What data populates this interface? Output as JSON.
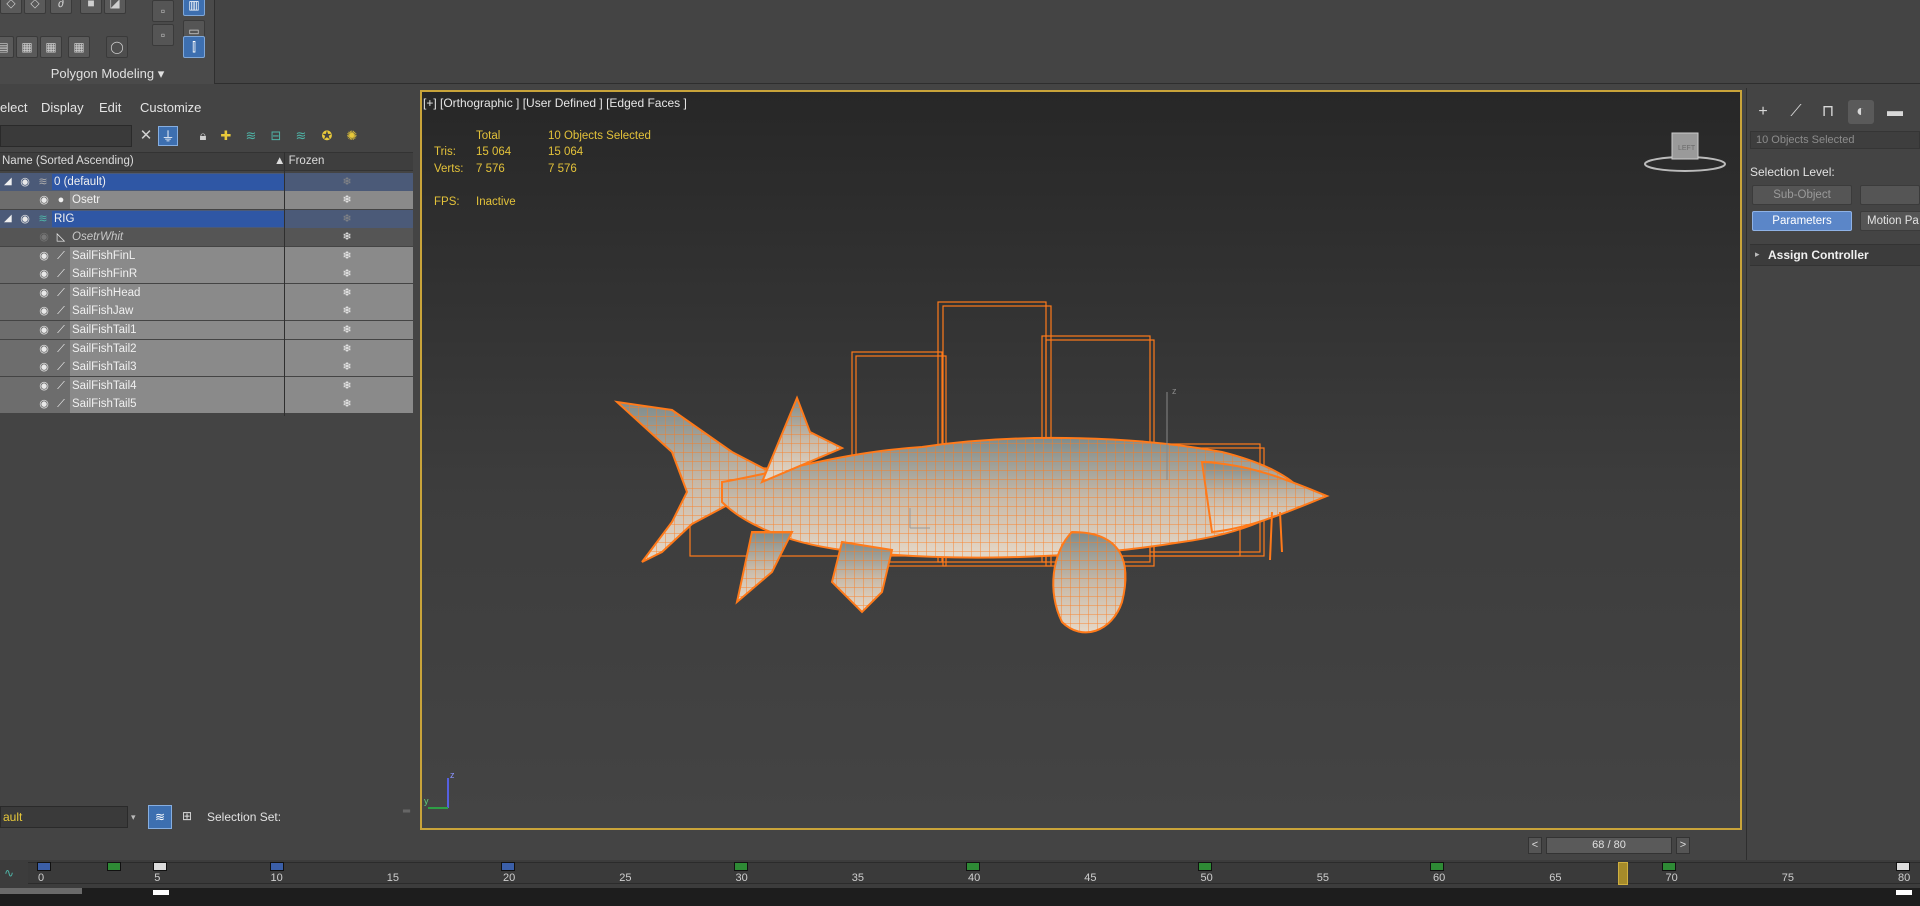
{
  "ribbon": {
    "tab_label": "Polygon Modeling ▾"
  },
  "explorer": {
    "menus": [
      "elect",
      "Display",
      "Edit",
      "Customize"
    ],
    "columns": {
      "name": "Name (Sorted Ascending)",
      "frozen": "▲ Frozen"
    },
    "rows": [
      {
        "name": "0 (default)"
      },
      {
        "name": "Osetr"
      },
      {
        "name": "RIG"
      },
      {
        "name": "OsetrWhit"
      },
      {
        "name": "SailFishFinL"
      },
      {
        "name": "SailFishFinR"
      },
      {
        "name": "SailFishHead"
      },
      {
        "name": "SailFishJaw"
      },
      {
        "name": "SailFishTail1"
      },
      {
        "name": "SailFishTail2"
      },
      {
        "name": "SailFishTail3"
      },
      {
        "name": "SailFishTail4"
      },
      {
        "name": "SailFishTail5"
      }
    ],
    "layer_dropdown": "ault",
    "selection_set_label": "Selection Set:"
  },
  "viewport": {
    "label": "[+] [Orthographic ] [User Defined ] [Edged Faces ]",
    "stats": {
      "total_header": "Total",
      "selected_header": "10 Objects Selected",
      "tris_label": "Tris:",
      "tris_total": "15 064",
      "tris_selected": "15 064",
      "verts_label": "Verts:",
      "verts_total": "7 576",
      "verts_selected": "7 576",
      "fps_label": "FPS:",
      "fps_value": "Inactive"
    },
    "viewcube_label": "LEFT",
    "colors": {
      "border": "#c9a43a",
      "wireframe": "#ff7a1a",
      "stats": "#e3c23a"
    }
  },
  "command_panel": {
    "selection_count": "10 Objects Selected",
    "selection_level": "Selection Level:",
    "sub_object": "Sub-Object",
    "parameters": "Parameters",
    "motion_paths": "Motion Pa",
    "assign_controller": "Assign Controller"
  },
  "timeline": {
    "frame_display": "68 / 80",
    "prev": "<",
    "next": ">",
    "ticks": [
      "0",
      "5",
      "10",
      "15",
      "20",
      "25",
      "30",
      "35",
      "40",
      "45",
      "50",
      "55",
      "60",
      "65",
      "70",
      "75",
      "80"
    ]
  }
}
